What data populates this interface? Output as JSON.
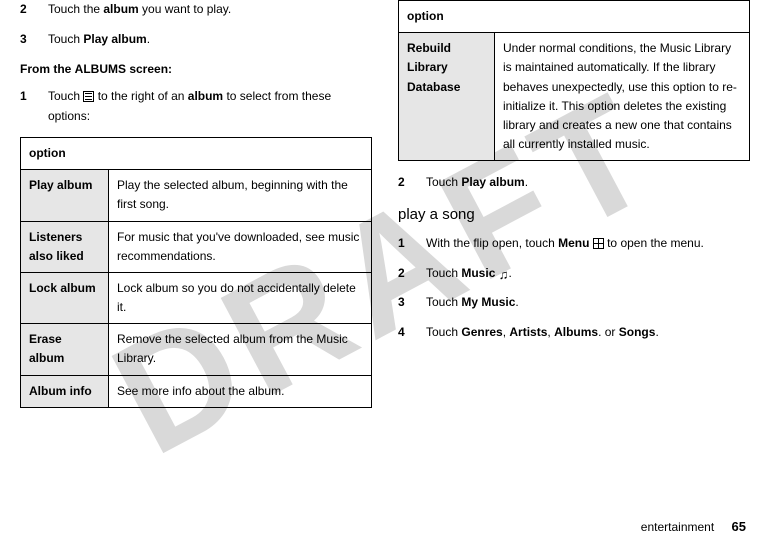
{
  "watermark": "DRAFT",
  "left": {
    "step2": {
      "num": "2",
      "pre": "Touch the ",
      "bold": "album",
      "post": " you want to play."
    },
    "step3": {
      "num": "3",
      "pre": "Touch ",
      "cond": "Play album",
      "post": "."
    },
    "heading_pre": "From the ",
    "heading_cond": "ALBUMS screen",
    "heading_post": ":",
    "step1": {
      "num": "1",
      "pre": "Touch ",
      "mid": " to the right of an ",
      "bold": "album",
      "post": " to select from these options:"
    },
    "table_header": "option",
    "rows": [
      {
        "label": "Play album",
        "desc": "Play the selected album, beginning with the first song."
      },
      {
        "label": "Listeners also liked",
        "desc": "For music that you've downloaded, see music recommendations."
      },
      {
        "label": "Lock album",
        "desc": "Lock album so you do not accidentally delete it."
      },
      {
        "label": "Erase album",
        "desc": "Remove the selected album from the Music Library."
      },
      {
        "label": "Album info",
        "desc": "See more info about the album."
      }
    ]
  },
  "right": {
    "table_header": "option",
    "rows": [
      {
        "label": "Rebuild Library Database",
        "desc": "Under normal conditions, the Music Library is maintained automatically. If the library behaves unexpectedly, use this option to re-initialize it. This option deletes the existing library and creates a new one that contains all currently installed music."
      }
    ],
    "step2": {
      "num": "2",
      "pre": "Touch ",
      "cond": "Play album",
      "post": "."
    },
    "subheading": "play a song",
    "s1": {
      "num": "1",
      "pre": "With the flip open, touch ",
      "cond": "Menu",
      "post": " to open the menu."
    },
    "s2": {
      "num": "2",
      "pre": "Touch ",
      "cond": "Music",
      "post": "."
    },
    "s3": {
      "num": "3",
      "pre": "Touch ",
      "cond": "My Music",
      "post": "."
    },
    "s4": {
      "num": "4",
      "pre": "Touch ",
      "c1": "Genres",
      "sep1": ", ",
      "c2": "Artists",
      "sep2": ", ",
      "c3": "Albums",
      "mid": ". or ",
      "c4": "Songs",
      "post": "."
    }
  },
  "footer": {
    "section": "entertainment",
    "page": "65"
  }
}
